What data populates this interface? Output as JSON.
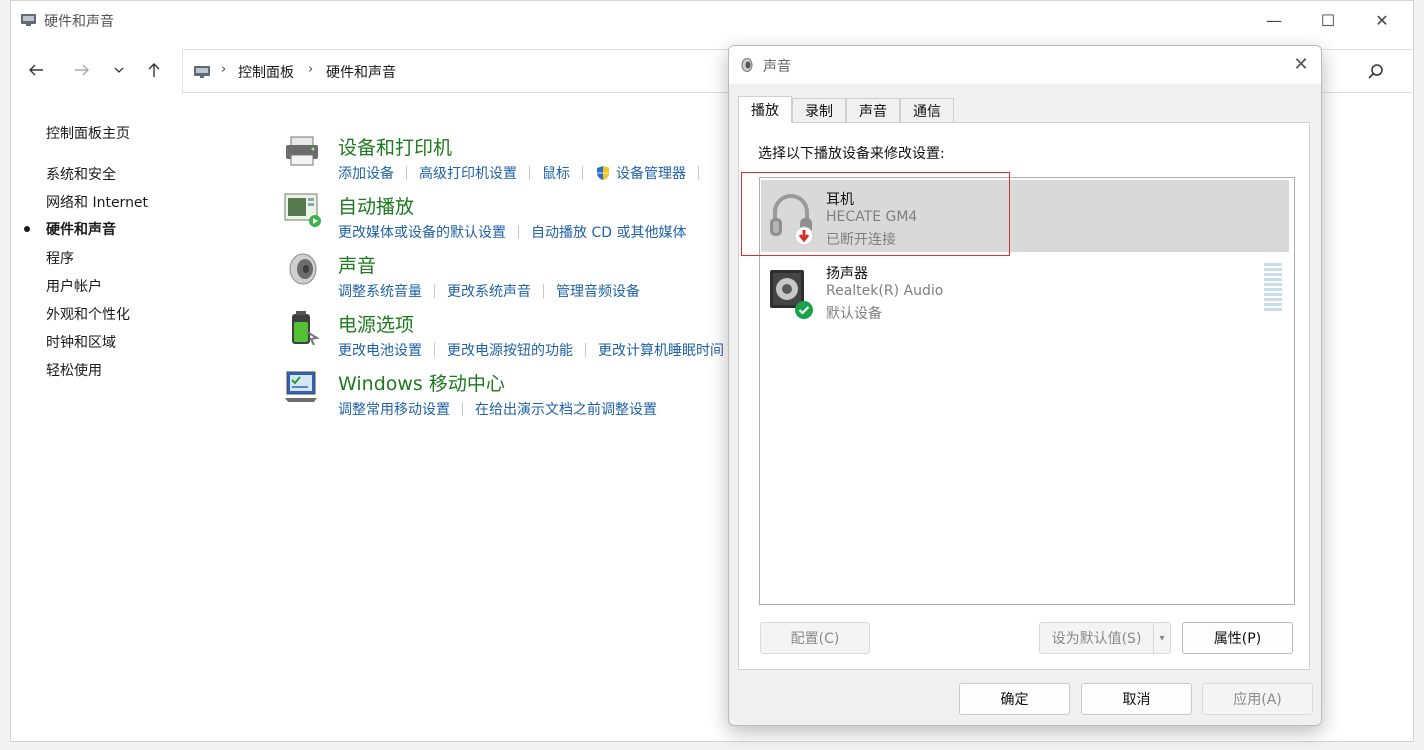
{
  "window": {
    "title": "硬件和声音",
    "controls": {
      "minimize": "—",
      "maximize": "☐",
      "close": "✕"
    }
  },
  "nav": {
    "back": "←",
    "forward": "→",
    "recent": "⌄",
    "up": "↑",
    "breadcrumb": [
      "控制面板",
      "硬件和声音"
    ],
    "separator": "›"
  },
  "sidebar": {
    "items": [
      {
        "label": "控制面板主页",
        "active": false
      },
      {
        "label": "系统和安全",
        "active": false
      },
      {
        "label": "网络和 Internet",
        "active": false
      },
      {
        "label": "硬件和声音",
        "active": true
      },
      {
        "label": "程序",
        "active": false
      },
      {
        "label": "用户帐户",
        "active": false
      },
      {
        "label": "外观和个性化",
        "active": false
      },
      {
        "label": "时钟和区域",
        "active": false
      },
      {
        "label": "轻松使用",
        "active": false
      }
    ]
  },
  "categories": [
    {
      "title": "设备和打印机",
      "icon": "printer-icon",
      "links": [
        "添加设备",
        "高级打印机设置",
        "鼠标",
        "设备管理器"
      ]
    },
    {
      "title": "自动播放",
      "icon": "autoplay-icon",
      "links": [
        "更改媒体或设备的默认设置",
        "自动播放 CD 或其他媒体"
      ]
    },
    {
      "title": "声音",
      "icon": "speaker-icon",
      "links": [
        "调整系统音量",
        "更改系统声音",
        "管理音频设备"
      ]
    },
    {
      "title": "电源选项",
      "icon": "battery-icon",
      "links": [
        "更改电池设置",
        "更改电源按钮的功能",
        "更改计算机睡眠时间"
      ]
    },
    {
      "title": "Windows 移动中心",
      "icon": "mobility-center-icon",
      "links": [
        "调整常用移动设置",
        "在给出演示文档之前调整设置"
      ]
    }
  ],
  "sound_dialog": {
    "title": "声音",
    "close": "✕",
    "tabs": [
      {
        "label": "播放",
        "active": true
      },
      {
        "label": "录制",
        "active": false
      },
      {
        "label": "声音",
        "active": false
      },
      {
        "label": "通信",
        "active": false
      }
    ],
    "instruction": "选择以下播放设备来修改设置:",
    "devices": [
      {
        "name": "耳机",
        "description": "HECATE GM4",
        "status": "已断开连接",
        "icon": "headphones-icon",
        "badge": "disconnected-arrow-icon",
        "selected": true
      },
      {
        "name": "扬声器",
        "description": "Realtek(R) Audio",
        "status": "默认设备",
        "icon": "speaker-device-icon",
        "badge": "default-check-icon",
        "selected": false
      }
    ],
    "buttons": {
      "configure": "配置(C)",
      "set_default": "设为默认值(S)",
      "set_default_arrow": "▾",
      "properties": "属性(P)",
      "ok": "确定",
      "cancel": "取消",
      "apply": "应用(A)"
    },
    "colors": {
      "highlight_box": "#d9302c",
      "category_title": "#1e7a1e",
      "link": "#2062a8"
    }
  }
}
